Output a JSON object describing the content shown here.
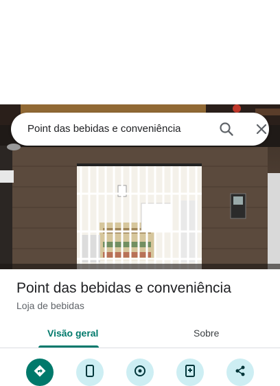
{
  "search": {
    "query": "Point das bebidas e conveniência"
  },
  "place": {
    "name": "Point das bebidas e conveniência",
    "category": "Loja de bebidas"
  },
  "tabs": [
    {
      "label": "Visão geral",
      "active": true
    },
    {
      "label": "Sobre",
      "active": false
    }
  ],
  "actions": [
    {
      "icon": "directions-icon",
      "primary": true
    },
    {
      "icon": "phone-icon",
      "primary": false
    },
    {
      "icon": "location-icon",
      "primary": false
    },
    {
      "icon": "save-icon",
      "primary": false
    },
    {
      "icon": "share-icon",
      "primary": false
    }
  ],
  "colors": {
    "accent": "#00796b",
    "action_bg": "#cdeef3",
    "title": "#202124",
    "secondary": "#5f6368"
  }
}
